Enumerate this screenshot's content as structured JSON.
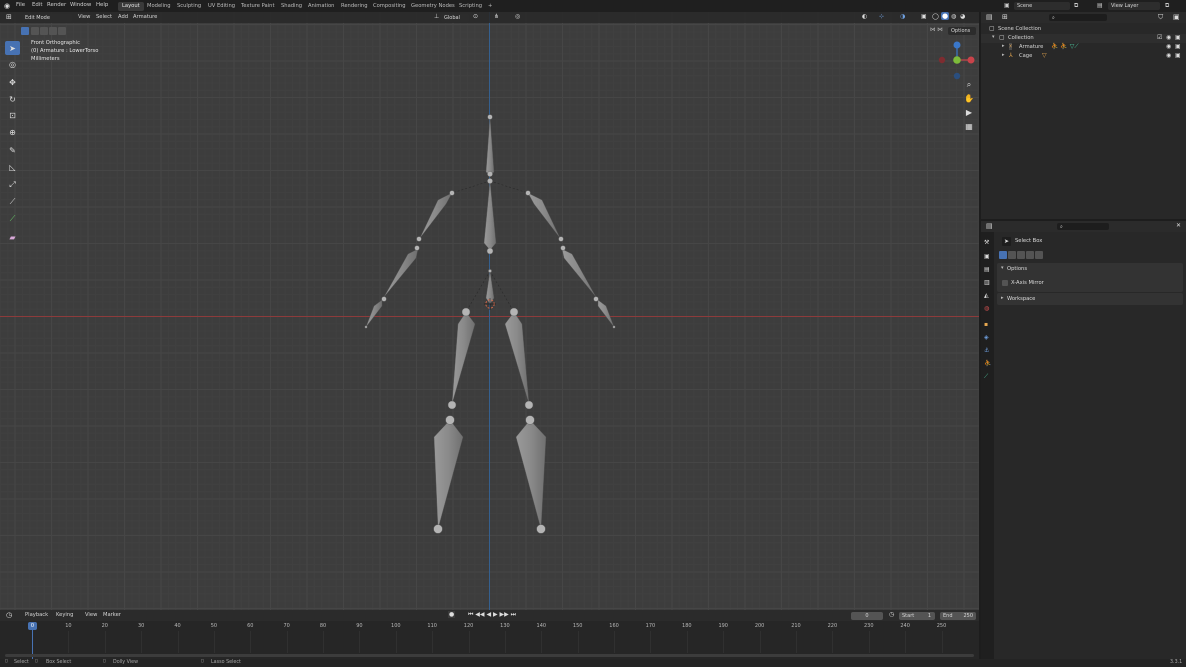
{
  "top_menu": [
    "File",
    "Edit",
    "Render",
    "Window",
    "Help"
  ],
  "workspaces": [
    "Layout",
    "Modeling",
    "Sculpting",
    "UV Editing",
    "Texture Paint",
    "Shading",
    "Animation",
    "Rendering",
    "Compositing",
    "Geometry Nodes",
    "Scripting"
  ],
  "add_workspace": "+",
  "scene": "Scene",
  "view_layer": "View Layer",
  "viewport_header": {
    "mode": "Edit Mode",
    "menus": [
      "View",
      "Select",
      "Add",
      "Armature"
    ],
    "orientation": "Global",
    "options": "Options"
  },
  "overlay": {
    "view_name": "Front Orthographic",
    "object_info": "(0) Armature : LowerTorso",
    "units": "Millimeters"
  },
  "toolbar_icons": [
    "select-box-icon",
    "cursor-icon",
    "move-icon",
    "rotate-icon",
    "scale-icon",
    "transform-icon",
    "annotate-icon",
    "measure-icon",
    "extrude-icon",
    "bone-size-icon",
    "bone-envelope-icon",
    "roll-icon"
  ],
  "outliner": {
    "root": "Scene Collection",
    "collection": "Collection",
    "items": [
      "Armature",
      "Cage"
    ]
  },
  "properties": {
    "tool_name": "Select Box",
    "sections": [
      "Options",
      "Workspace"
    ],
    "x_axis_mirror": "X-Axis Mirror"
  },
  "timeline": {
    "menus": [
      "Playback",
      "Keying",
      "View",
      "Marker"
    ],
    "current_frame": "0",
    "start_label": "Start",
    "start": "1",
    "end_label": "End",
    "end": "250",
    "ticks": [
      "0",
      "10",
      "20",
      "30",
      "40",
      "50",
      "60",
      "70",
      "80",
      "90",
      "100",
      "110",
      "120",
      "130",
      "140",
      "150",
      "160",
      "170",
      "180",
      "190",
      "200",
      "210",
      "220",
      "230",
      "240",
      "250"
    ]
  },
  "status_bar": {
    "select": "Select",
    "box_select": "Box Select",
    "dolly_view": "Dolly View",
    "lasso_select": "Lasso Select",
    "version": "3.3.1"
  },
  "colors": {
    "active_blue": "#4772b3",
    "viewport_bg": "#3d3d3d",
    "x_axis": "#9b3a3a",
    "z_axis": "#3a6ea8",
    "bone": "#8a8a8a"
  }
}
